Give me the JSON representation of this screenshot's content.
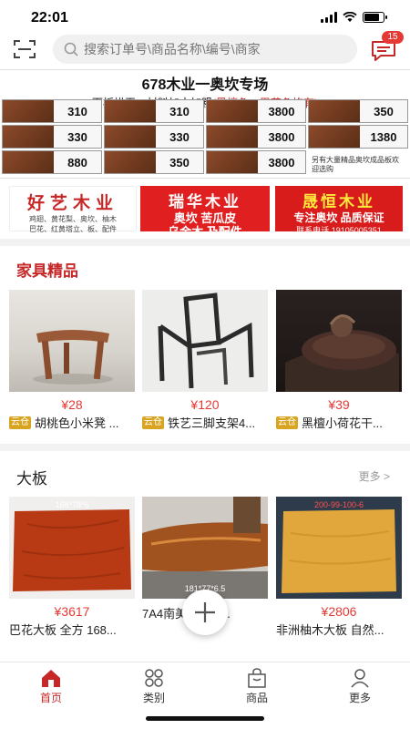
{
  "status": {
    "time": "22:01",
    "battery_level": 0.85
  },
  "search": {
    "placeholder": "搜索订单号\\商品名称\\编号\\商家"
  },
  "messages": {
    "badge": "15"
  },
  "banner": {
    "title": "678木业一奥坎专场",
    "subtitle_prefix": "面板烘干、材料加大加粗",
    "subtitle_highlight": "(黑檀色、巴花色均有)",
    "prices": [
      "310",
      "310",
      "3800",
      "350",
      "330",
      "330",
      "3800",
      "1380",
      "880",
      "350",
      "3800",
      ""
    ],
    "note": "另有大量精品奥坎成品板欢迎选购"
  },
  "ads": [
    {
      "title": "好艺木业",
      "lines": [
        "鸡翅、黄花梨、奥坎、柚木",
        "巴花、红黄塔立、板、配件"
      ]
    },
    {
      "title": "瑞华木业",
      "lines": [
        "奥坎 苦瓜皮",
        "乌金木 及配件"
      ]
    },
    {
      "title": "晟恒木业",
      "lines": [
        "专注奥坎 品质保证"
      ],
      "phone": "联系电话 19105005351"
    }
  ],
  "section1": {
    "title": "家具精品",
    "items": [
      {
        "price": "¥28",
        "tag": "云仓",
        "name": "胡桃色小米凳 ..."
      },
      {
        "price": "¥120",
        "tag": "云仓",
        "name": "铁艺三脚支架4..."
      },
      {
        "price": "¥39",
        "tag": "云仓",
        "name": "黑檀小荷花干..."
      }
    ]
  },
  "section2": {
    "title": "大板",
    "more": "更多 >",
    "items": [
      {
        "price": "¥3617",
        "name": "巴花大板 全方 168...",
        "img_label": "168*78*6"
      },
      {
        "price": "",
        "name": "7A4南美...木大...",
        "img_label": "181*77*6.5"
      },
      {
        "price": "¥2806",
        "name": "非洲柚木大板 自然...",
        "img_label": "200-99-100-6"
      }
    ]
  },
  "tabs": [
    {
      "label": "首页",
      "icon": "home-icon",
      "active": true
    },
    {
      "label": "类别",
      "icon": "category-icon",
      "active": false
    },
    {
      "label": "商品",
      "icon": "bag-icon",
      "active": false
    },
    {
      "label": "更多",
      "icon": "user-icon",
      "active": false
    }
  ],
  "colors": {
    "accent": "#c62828",
    "price": "#e53935"
  }
}
